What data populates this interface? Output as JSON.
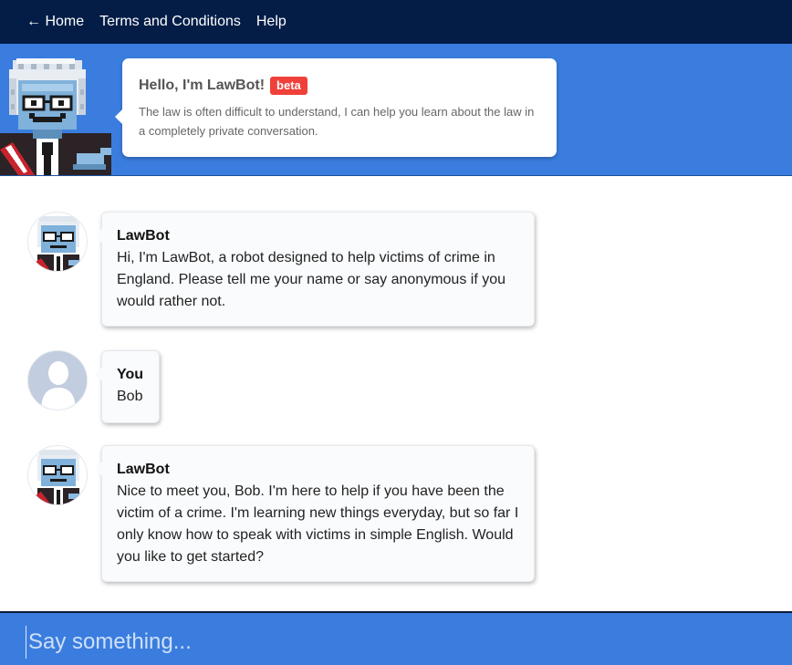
{
  "nav": {
    "home": "← Home",
    "terms": "Terms and Conditions",
    "help": "Help"
  },
  "hero": {
    "title": "Hello, I'm LawBot!",
    "badge": "beta",
    "description": "The law is often difficult to understand, I can help you learn about the law in a completely private conversation."
  },
  "messages": [
    {
      "sender": "LawBot",
      "text": "Hi, I'm LawBot, a robot designed to help victims of crime in England. Please tell me your name or say anonymous if you would rather not."
    },
    {
      "sender": "You",
      "text": "Bob"
    },
    {
      "sender": "LawBot",
      "text": "Nice to meet you, Bob. I'm here to help if you have been the victim of a crime. I'm learning new things everyday, but so far I only know how to speak with victims in simple English. Would you like to get started?"
    }
  ],
  "input": {
    "placeholder": "Say something..."
  },
  "colors": {
    "nav_bg": "#031d47",
    "header_blue": "#3a7ddf",
    "badge_red": "#f0403a"
  }
}
